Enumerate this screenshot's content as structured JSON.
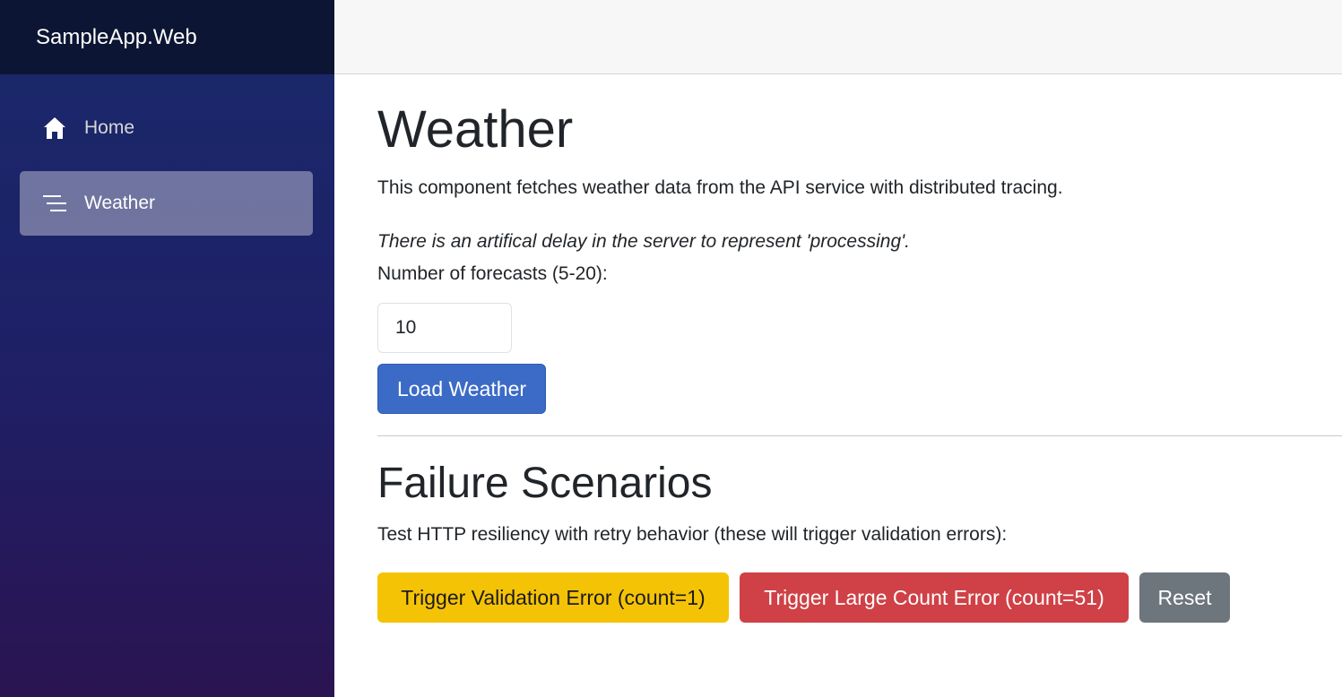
{
  "app": {
    "brand": "SampleApp.Web"
  },
  "sidebar": {
    "items": [
      {
        "label": "Home",
        "icon": "home-icon",
        "active": false
      },
      {
        "label": "Weather",
        "icon": "list-lines-icon",
        "active": true
      }
    ]
  },
  "main": {
    "title": "Weather",
    "description": "This component fetches weather data from the API service with distributed tracing.",
    "note": "There is an artifical delay in the server to represent 'processing'.",
    "forecast_label": "Number of forecasts (5-20):",
    "forecast_value": "10",
    "load_button": "Load Weather"
  },
  "failure": {
    "title": "Failure Scenarios",
    "description": "Test HTTP resiliency with retry behavior (these will trigger validation errors):",
    "validation_button": "Trigger Validation Error (count=1)",
    "large_count_button": "Trigger Large Count Error (count=51)",
    "reset_button": "Reset"
  },
  "colors": {
    "primary": "#3b6bc6",
    "warning": "#f5c306",
    "danger": "#cf4146",
    "secondary": "#6d757d",
    "sidebar_top": "#192a6b",
    "sidebar_bottom": "#2a1451"
  }
}
